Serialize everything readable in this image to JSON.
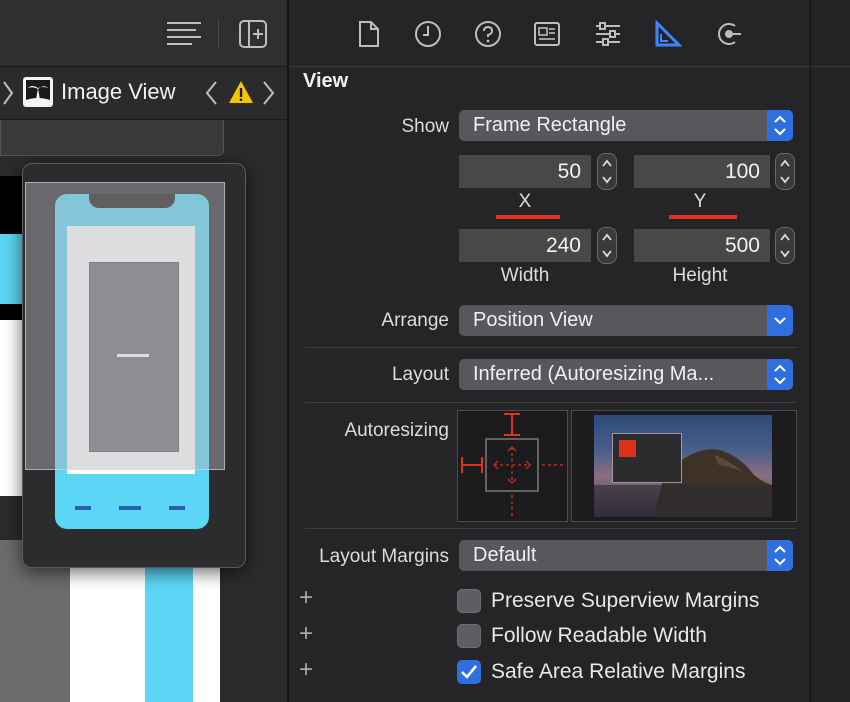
{
  "jumpbar": {
    "item_label": "Image View"
  },
  "inspector": {
    "section_title": "View",
    "show": {
      "label": "Show",
      "value": "Frame Rectangle"
    },
    "frame": {
      "x": {
        "value": "50",
        "label": "X"
      },
      "y": {
        "value": "100",
        "label": "Y"
      },
      "width": {
        "value": "240",
        "label": "Width"
      },
      "height": {
        "value": "500",
        "label": "Height"
      }
    },
    "arrange": {
      "label": "Arrange",
      "value": "Position View"
    },
    "layout": {
      "label": "Layout",
      "value": "Inferred (Autoresizing Ma..."
    },
    "autoresizing": {
      "label": "Autoresizing"
    },
    "layout_margins": {
      "label": "Layout Margins",
      "value": "Default"
    },
    "checkboxes": [
      {
        "label": "Preserve Superview Margins",
        "checked": false
      },
      {
        "label": "Follow Readable Width",
        "checked": false
      },
      {
        "label": "Safe Area Relative Margins",
        "checked": true
      }
    ]
  },
  "colors": {
    "accent": "#2f6fe0",
    "warning": "#f5c400",
    "red_marker": "#e0301e",
    "phone": "#5bd6f5"
  },
  "icons": [
    "editor-options-icon",
    "add-editor-icon",
    "file-inspector-icon",
    "history-inspector-icon",
    "quick-help-icon",
    "identity-inspector-icon",
    "attributes-inspector-icon",
    "size-inspector-icon",
    "connections-inspector-icon",
    "image-view-icon",
    "warning-icon"
  ]
}
